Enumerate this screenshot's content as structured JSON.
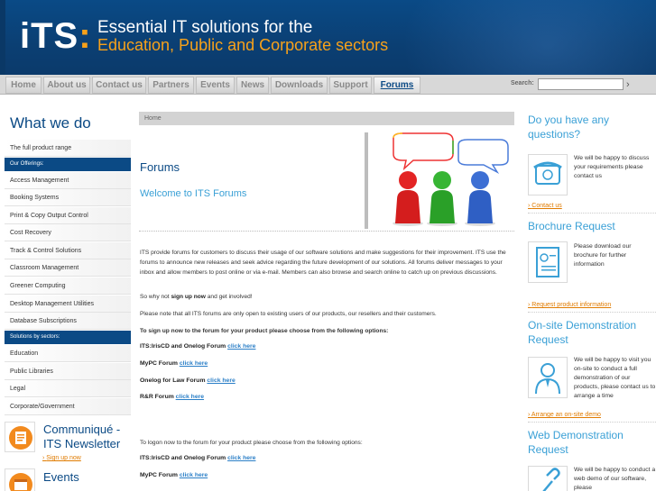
{
  "header": {
    "logo_text": "iTS",
    "logo_colon": ":",
    "tagline_line1": "Essential IT solutions for the",
    "tagline_line2": "Education, Public and Corporate sectors"
  },
  "nav": {
    "items": [
      {
        "label": "Home"
      },
      {
        "label": "About us"
      },
      {
        "label": "Contact us"
      },
      {
        "label": "Partners"
      },
      {
        "label": "Events"
      },
      {
        "label": "News"
      },
      {
        "label": "Downloads"
      },
      {
        "label": "Support"
      },
      {
        "label": "Forums",
        "active": true
      }
    ],
    "search_label": "Search:",
    "search_value": "",
    "search_go": "›"
  },
  "sidebar": {
    "heading": "What we do",
    "full_range": "The full product range",
    "offerings_header": "Our Offerings:",
    "offerings": [
      "Access Management",
      "Booking Systems",
      "Print & Copy Output Control",
      "Cost Recovery",
      "Track & Control Solutions",
      "Classroom Management",
      "Greener Computing",
      "Desktop Management Utilities",
      "Database Subscriptions"
    ],
    "sectors_header": "Solutions by sectors:",
    "sectors": [
      "Education",
      "Public Libraries",
      "Legal",
      "Corporate/Government"
    ],
    "newsletter_title1": "Communiqué -",
    "newsletter_title2": "ITS Newsletter",
    "newsletter_link": "Sign up now",
    "events_title": "Events"
  },
  "main": {
    "breadcrumb": "Home",
    "title": "Forums",
    "welcome": "Welcome to ITS Forums",
    "intro": "ITS provide forums for customers to discuss their usage of our software solutions and make suggestions for their improvement. ITS use the forums to announce new releases and seek advice regarding the future development of our solutions. All forums deliver messages to your inbox and allow members to post online or via e-mail. Members can also browse and search online to catch up on previous discussions.",
    "signup_pre": "So why not ",
    "signup_bold": "sign up now",
    "signup_post": " and get involved!",
    "note": "Please note that all ITS forums are only open to existing users of our products, our resellers and their customers.",
    "signup_instruction": "To sign up now to the forum for your product please choose from the following options:",
    "signup_forums": [
      {
        "name": "ITS:IrisCD and Onelog Forum",
        "link": "click here"
      },
      {
        "name": "MyPC Forum",
        "link": "click here"
      },
      {
        "name": "Onelog for Law Forum",
        "link": "click here"
      },
      {
        "name": "R&R Forum",
        "link": "click here"
      }
    ],
    "logon_instruction": "To logon now to the forum for your product please choose from the following options:",
    "logon_forums": [
      {
        "name": "ITS:IrisCD and Onelog Forum",
        "link": "click here"
      },
      {
        "name": "MyPC Forum",
        "link": "click here"
      }
    ]
  },
  "right": {
    "questions_title": "Do you have any questions?",
    "questions_text": "We will be happy to discuss your requirements please contact us",
    "questions_link": "Contact us",
    "brochure_title": "Brochure Request",
    "brochure_text": "Please download our brochure for further information",
    "brochure_link": "Request product information",
    "demo_title": "On-site Demonstration Request",
    "demo_text": "We will be happy to visit you on-site to conduct a full demonstration of our products, please contact us to arrange a time",
    "demo_link": "Arrange an on-site demo",
    "web_title": "Web Demonstration Request",
    "web_text": "We will be happy to conduct a web demo of our software, please"
  },
  "colors": {
    "header_blue": "#0b4a85",
    "accent_orange": "#f7a11a",
    "link_orange": "#e07b00",
    "light_blue": "#3aa0d6"
  }
}
